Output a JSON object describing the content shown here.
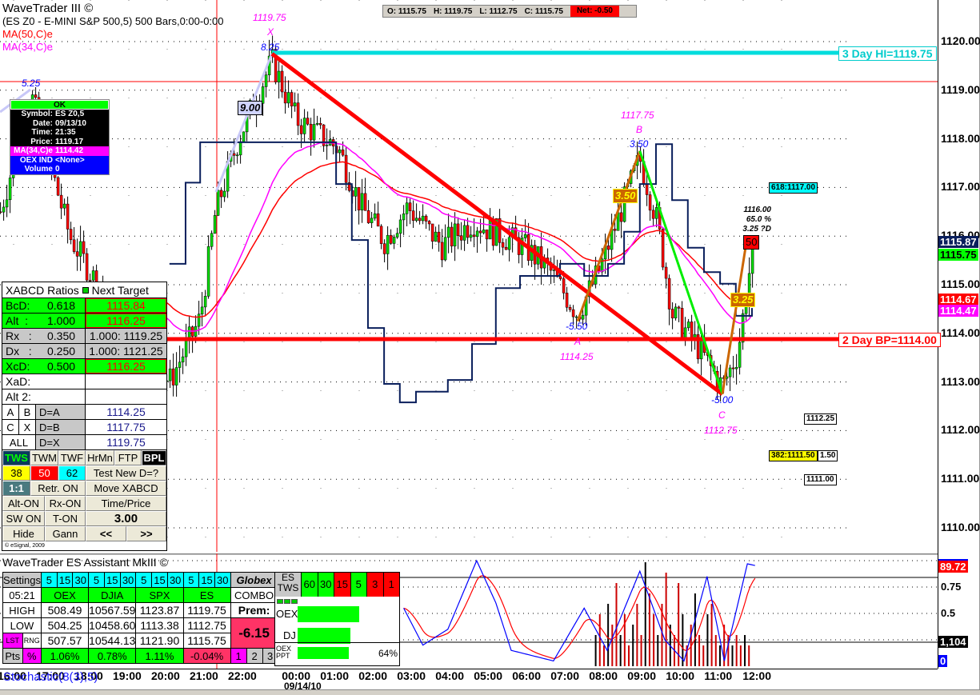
{
  "header": {
    "app_title": "WaveTrader III ©",
    "symbol_line": "(ES Z0 - E-MINI S&P 500,5) 500 Bars,0:00-0:00",
    "ma50_label": "MA(50,C)e",
    "ma34_label": "MA(34,C)e"
  },
  "ohlc_bar": {
    "open": "O: 1115.75",
    "high": "H: 1119.75",
    "low": "L: 1112.75",
    "close": "C: 1115.75",
    "net": "Net: -0.50"
  },
  "data_window": {
    "ok_label": "OK",
    "rows": [
      {
        "k": "Symbol:",
        "v": "ES Z0,5"
      },
      {
        "k": "Date:",
        "v": "09/13/10"
      },
      {
        "k": "Time:",
        "v": "21:35"
      },
      {
        "k": "Price:",
        "v": "1119.17"
      }
    ],
    "ma_row": {
      "k": "MA(34,C)e",
      "v": "1114.42"
    },
    "oex_row": {
      "k": "OEX IND",
      "v": "<None>"
    },
    "vol_row": {
      "k": "Volume",
      "v": "0"
    }
  },
  "price_axis": {
    "ticks": [
      "1120.00",
      "1119.00",
      "1118.00",
      "1117.00",
      "1116.00",
      "1115.00",
      "1114.00",
      "1113.00",
      "1112.00",
      "1111.00",
      "1110.00"
    ],
    "tick_values": [
      1120,
      1119,
      1118,
      1117,
      1116,
      1115,
      1114,
      1113,
      1112,
      1111,
      1110
    ],
    "tags": [
      {
        "text": "1115.87",
        "color": "#0a1f5c"
      },
      {
        "text": "1115.75",
        "color": "#00ff00"
      },
      {
        "text": "1114.67",
        "color": "#ff0000"
      },
      {
        "text": "1114.47",
        "color": "#ff00ff"
      }
    ]
  },
  "levels": {
    "three_day_hi": "3 Day HI=1119.75",
    "two_day_bp": "2 Day BP=1114.00",
    "fib_618": "618:1117.00",
    "fib_382": "382:1111.50",
    "fib_382_diff": "1.50",
    "level_1112": "1112.25",
    "level_1111": "1111.00"
  },
  "pattern": {
    "x_price": "1119.75",
    "x_letter": "X",
    "x_swing": "8.25",
    "left_swing": "5.25",
    "xa_leg": "9.00",
    "a_price": "1114.25",
    "a_letter": "A",
    "a_swing": "-5.50",
    "b_price": "1117.75",
    "b_letter": "B",
    "b_swing": "3.50",
    "ab_leg": "3.50",
    "c_price": "1112.75",
    "c_letter": "C",
    "c_swing": "-5.00",
    "cd_leg": "3.25",
    "d_badge": "50",
    "proj_price": "1116.00",
    "proj_pct": "65.0 %",
    "proj_pts": "3.25 ?D",
    "points": {
      "X": [
        6.77,
        1119.75
      ],
      "A": [
        14.73,
        1114.25
      ],
      "B": [
        16.35,
        1117.75
      ],
      "C": [
        18.5,
        1112.75
      ],
      "D": [
        19.15,
        1116.0
      ]
    }
  },
  "xabcd": {
    "header": "XABCD Ratios",
    "header2": "Next Target",
    "rows": [
      {
        "label": "BcD:",
        "ratio": "0.618",
        "target": "1115.84"
      },
      {
        "label": "Alt  :",
        "ratio": "1.000",
        "target": "1116.25"
      },
      {
        "label": "Rx   :",
        "ratio": "0.350",
        "target": "1.000: 1119.25"
      },
      {
        "label": "Dx   :",
        "ratio": "0.250",
        "target": "1.000: 1121.25"
      },
      {
        "label": "XcD:",
        "ratio": "0.500",
        "target": "1116.25"
      },
      {
        "label": "XaD:",
        "ratio": "",
        "target": ""
      },
      {
        "label": "Alt 2:",
        "ratio": "",
        "target": ""
      }
    ],
    "points": [
      {
        "a": "A",
        "b": "B",
        "d": "D=A",
        "v": "1114.25"
      },
      {
        "a": "C",
        "b": "X",
        "d": "D=B",
        "v": "1117.75"
      },
      {
        "a": "ALL",
        "b": "",
        "d": "D=X",
        "v": "1119.75"
      }
    ],
    "buttons": {
      "tws": "TWS",
      "twm": "TWM",
      "twf": "TWF",
      "hrmn": "HrMn",
      "ftp": "FTP",
      "bpl": "BPL",
      "b38": "38",
      "b50": "50",
      "b62": "62",
      "test_new_d": "Test New D=?",
      "ratio11": "1:1",
      "retr_on": "Retr. ON",
      "move_xabcd": "Move XABCD",
      "alt_on": "Alt-ON",
      "rx_on": "Rx-ON",
      "time_price": "Time/Price",
      "sw_on": "SW ON",
      "t_on": "T-ON",
      "value": "3.00",
      "hide": "Hide",
      "gann": "Gann",
      "prev": "<<",
      "next": ">>"
    },
    "copyright": "© eSignal, 2009"
  },
  "assistant": {
    "title": "WaveTrader ES Assistant MkIII ©",
    "settings": "Settings",
    "intervals": [
      "5",
      "15",
      "30",
      "5",
      "15",
      "30",
      "5",
      "15",
      "30",
      "5",
      "15",
      "30"
    ],
    "globex": "Globex",
    "time": "05:21",
    "columns": [
      "OEX",
      "DJIA",
      "SPX",
      "ES"
    ],
    "combo": "COMBO",
    "high_label": "HIGH",
    "high": [
      "508.49",
      "10567.59",
      "1123.87",
      "1119.75"
    ],
    "prem_label": "Prem:",
    "low_label": "LOW",
    "low": [
      "504.25",
      "10458.60",
      "1113.38",
      "1112.75"
    ],
    "prem_value": "-6.15",
    "lst_label": "LST",
    "rng_label": "RNG",
    "last": [
      "507.57",
      "10544.13",
      "1121.90",
      "1115.75"
    ],
    "pts_label": "Pts",
    "pct_label": "%",
    "pct": [
      "1.06%",
      "0.78%",
      "1.11%",
      "-0.04%"
    ],
    "pages": [
      "1",
      "2",
      "3"
    ],
    "es_tws": "ES TWS",
    "tws_frames": [
      {
        "t": "60",
        "c": "#00ff00"
      },
      {
        "t": "30",
        "c": "#00ff00"
      },
      {
        "t": "15",
        "c": "#ff0000"
      },
      {
        "t": "5",
        "c": "#00ff00"
      },
      {
        "t": "3",
        "c": "#ff0000"
      },
      {
        "t": "1",
        "c": "#ff0000"
      }
    ],
    "oex_label": "OEX",
    "oex_bar": 0.73,
    "dj_label": "DJ",
    "dj_bar": 0.63,
    "ppt_label": "OEX PPT",
    "ppt_bar": 0.64,
    "ppt_pct": "64%"
  },
  "lower_axis": {
    "stoch_tag": "89.72",
    "t075": "0.75",
    "t05": "0.5",
    "vol_tag": "1,104",
    "zero_tag": "0"
  },
  "time_axis": {
    "labels": [
      {
        "t": "16:00",
        "h": 0
      },
      {
        "t": "17:00",
        "h": 1
      },
      {
        "t": "18:00",
        "h": 2
      },
      {
        "t": "19:00",
        "h": 3
      },
      {
        "t": "20:00",
        "h": 4
      },
      {
        "t": "21:00",
        "h": 5
      },
      {
        "t": "22:00",
        "h": 6
      },
      {
        "t": "00:00",
        "h": 7.4
      },
      {
        "t": "01:00",
        "h": 8.4
      },
      {
        "t": "02:00",
        "h": 9.4
      },
      {
        "t": "03:00",
        "h": 10.4
      },
      {
        "t": "04:00",
        "h": 11.4
      },
      {
        "t": "05:00",
        "h": 12.4
      },
      {
        "t": "06:00",
        "h": 13.4
      },
      {
        "t": "07:00",
        "h": 14.4
      },
      {
        "t": "08:00",
        "h": 15.4
      },
      {
        "t": "09:00",
        "h": 16.4
      },
      {
        "t": "10:00",
        "h": 17.4
      },
      {
        "t": "11:00",
        "h": 18.4
      },
      {
        "t": "12:00",
        "h": 19.4
      }
    ],
    "date": "09/14/10",
    "study_label": "Stochastic(8(3),5)"
  },
  "chart_data": {
    "type": "candlestick",
    "price_path": [
      [
        -0.3,
        1116.5
      ],
      [
        0.5,
        1118.9
      ],
      [
        1.5,
        1116.0
      ],
      [
        2.8,
        1114.2
      ],
      [
        4.1,
        1113.0
      ],
      [
        4.9,
        1114.3
      ],
      [
        5.3,
        1116.5
      ],
      [
        5.9,
        1118.0
      ],
      [
        6.77,
        1119.6
      ],
      [
        7.4,
        1118.4
      ],
      [
        8.5,
        1117.8
      ],
      [
        9.1,
        1116.6
      ],
      [
        9.7,
        1115.9
      ],
      [
        10.3,
        1116.6
      ],
      [
        11.2,
        1115.8
      ],
      [
        12.0,
        1116.3
      ],
      [
        13.3,
        1115.8
      ],
      [
        14.0,
        1115.3
      ],
      [
        14.73,
        1114.4
      ],
      [
        15.3,
        1115.3
      ],
      [
        16.35,
        1117.6
      ],
      [
        16.8,
        1116.3
      ],
      [
        17.2,
        1114.4
      ],
      [
        17.8,
        1113.8
      ],
      [
        18.5,
        1112.9
      ],
      [
        18.9,
        1113.6
      ],
      [
        19.3,
        1115.8
      ]
    ],
    "step_line": [
      [
        4.1,
        1115.43
      ],
      [
        4.52,
        1117.1
      ],
      [
        4.9,
        1117.93
      ],
      [
        8.02,
        1117.93
      ],
      [
        8.44,
        1117.07
      ],
      [
        8.85,
        1115.92
      ],
      [
        9.27,
        1114.11
      ],
      [
        9.69,
        1112.96
      ],
      [
        10.1,
        1112.58
      ],
      [
        10.52,
        1112.8
      ],
      [
        11.35,
        1113.04
      ],
      [
        11.98,
        1113.78
      ],
      [
        12.6,
        1114.93
      ],
      [
        13.23,
        1115.18
      ],
      [
        14.27,
        1115.43
      ],
      [
        14.9,
        1115.18
      ],
      [
        15.52,
        1115.43
      ],
      [
        15.94,
        1116.09
      ],
      [
        16.35,
        1117.07
      ],
      [
        16.77,
        1117.89
      ],
      [
        17.19,
        1116.74
      ],
      [
        17.6,
        1115.76
      ],
      [
        18.02,
        1115.26
      ],
      [
        18.44,
        1115.02
      ],
      [
        18.85,
        1114.36
      ],
      [
        19.27,
        1114.52
      ]
    ],
    "stochastic": [
      [
        10.2,
        0.55
      ],
      [
        10.7,
        0.2
      ],
      [
        11.35,
        0.35
      ],
      [
        12.1,
        1.0
      ],
      [
        12.6,
        0.6
      ],
      [
        13.0,
        0.15
      ],
      [
        14.1,
        0.05
      ],
      [
        14.9,
        0.55
      ],
      [
        15.5,
        0.15
      ],
      [
        16.35,
        0.9
      ],
      [
        17.0,
        0.25
      ],
      [
        17.5,
        0.05
      ],
      [
        18.1,
        0.85
      ],
      [
        18.55,
        0.05
      ],
      [
        19.15,
        0.97
      ],
      [
        19.4,
        0.95
      ]
    ],
    "volume": [
      0.3,
      0.5,
      0.2,
      0.6,
      0.4,
      0.8,
      0.3,
      0.5,
      0.2,
      0.4,
      0.6,
      0.3,
      1.0,
      0.7,
      0.5,
      0.3,
      0.6,
      0.9,
      0.4,
      0.3,
      0.8,
      0.5,
      0.2,
      0.4,
      0.7,
      0.3,
      0.2,
      0.5,
      0.6,
      0.3,
      0.2,
      0.4,
      0.3,
      0.2,
      0.3,
      0.2,
      0.3,
      0.2
    ],
    "ylim": [
      1109.4,
      1121
    ]
  },
  "colors": {
    "up": "#00dd00",
    "down": "#ff0000",
    "ma50": "#ff0000",
    "ma34": "#ff00ff",
    "step": "#0a1f5c",
    "cyan": "#00dddd"
  }
}
